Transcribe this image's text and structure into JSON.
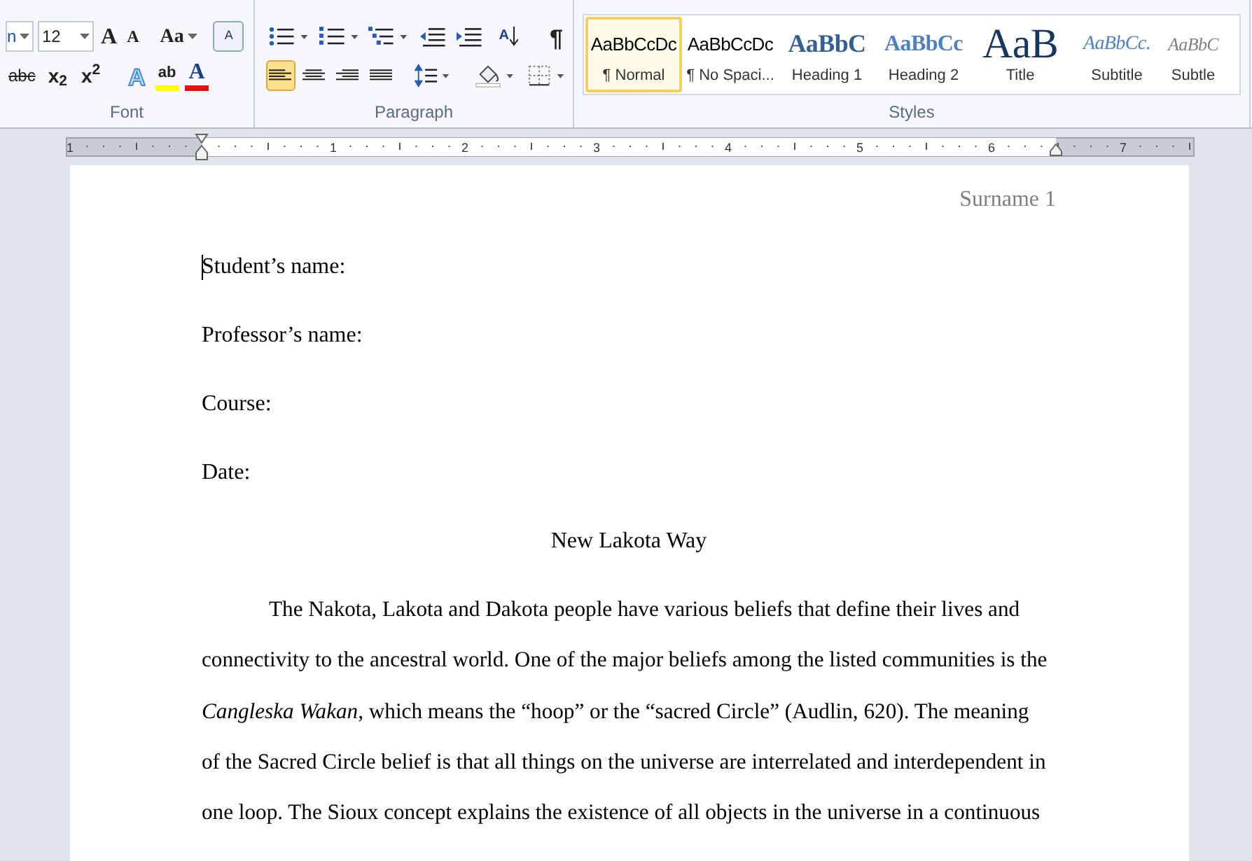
{
  "ribbon": {
    "font": {
      "label": "Font",
      "font_name": "n",
      "size": "12",
      "row1": [
        {
          "kind": "grow",
          "glyph": "A"
        },
        {
          "kind": "shrink",
          "glyph": "A"
        },
        {
          "kind": "case",
          "glyph": "Aa"
        },
        {
          "kind": "clear",
          "glyph": "A"
        }
      ],
      "row2": [
        {
          "kind": "strike",
          "glyph": "abc"
        },
        {
          "kind": "sub",
          "glyph": "x",
          "index": "2"
        },
        {
          "kind": "sup",
          "glyph": "x",
          "index": "2"
        },
        {
          "kind": "effects",
          "glyph": "A"
        },
        {
          "kind": "highlight",
          "glyph": "ab"
        },
        {
          "kind": "color",
          "glyph": "A"
        }
      ]
    },
    "paragraph": {
      "label": "Paragraph",
      "sort_glyph": "A",
      "pilcrow": "¶",
      "alignment": [
        {
          "kind": "left",
          "selected": true
        },
        {
          "kind": "center",
          "selected": false
        },
        {
          "kind": "right",
          "selected": false
        },
        {
          "kind": "justify",
          "selected": false
        }
      ]
    },
    "styles": {
      "label": "Styles",
      "items": [
        {
          "kind": "normal",
          "sample": "AaBbCcDc",
          "name": "¶ Normal",
          "selected": true
        },
        {
          "kind": "normal",
          "sample": "AaBbCcDc",
          "name": "¶ No Spaci...",
          "selected": false
        },
        {
          "kind": "heading1",
          "sample": "AaBbC",
          "name": "Heading 1",
          "selected": false
        },
        {
          "kind": "heading2",
          "sample": "AaBbCc",
          "name": "Heading 2",
          "selected": false
        },
        {
          "kind": "title",
          "sample": "AaB",
          "name": "Title",
          "selected": false
        },
        {
          "kind": "subtitle",
          "sample": "AaBbCc.",
          "name": "Subtitle",
          "selected": false
        },
        {
          "kind": "subtle",
          "sample": "AaBbC",
          "name": "Subtle",
          "selected": false
        }
      ]
    }
  },
  "ruler": {
    "marks": [
      "1",
      "1",
      "2",
      "3",
      "4",
      "5",
      "6",
      "7"
    ]
  },
  "document": {
    "header": "Surname 1",
    "lines": [
      "Student’s name:",
      "Professor’s name:",
      "Course:",
      "Date:"
    ],
    "title": "New Lakota Way",
    "paragraph": "The Nakota, Lakota and Dakota people have various beliefs that define their lives and connectivity to the ancestral world. One of the major beliefs among the listed communities is the *Cangleska Wakan*, which means the “hoop” or the “sacred Circle” (Audlin, 620). The meaning of the Sacred Circle belief is that all things on the universe are interrelated and interdependent in one loop. The Sioux concept explains the existence of all objects in the universe in a continuous"
  }
}
